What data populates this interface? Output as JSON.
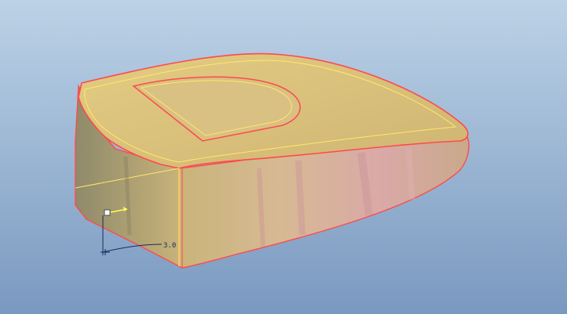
{
  "viewport": {
    "background_top": "#b9d0e4",
    "background_bottom": "#7c9bc2"
  },
  "model": {
    "name": "3d-shell-part",
    "fill_color": "#d8bf7a",
    "shade_color": "#b9a06a",
    "pink_tint": "#d49aa6",
    "edge_color_outer": "#ff4a4a",
    "edge_color_inner": "#ffe76a"
  },
  "annotation": {
    "dimension_value": "3.0",
    "dimension_color": "#1a2a5a"
  },
  "drag_handle": {
    "color": "#ffffff",
    "arrow_color": "#ffff55"
  }
}
